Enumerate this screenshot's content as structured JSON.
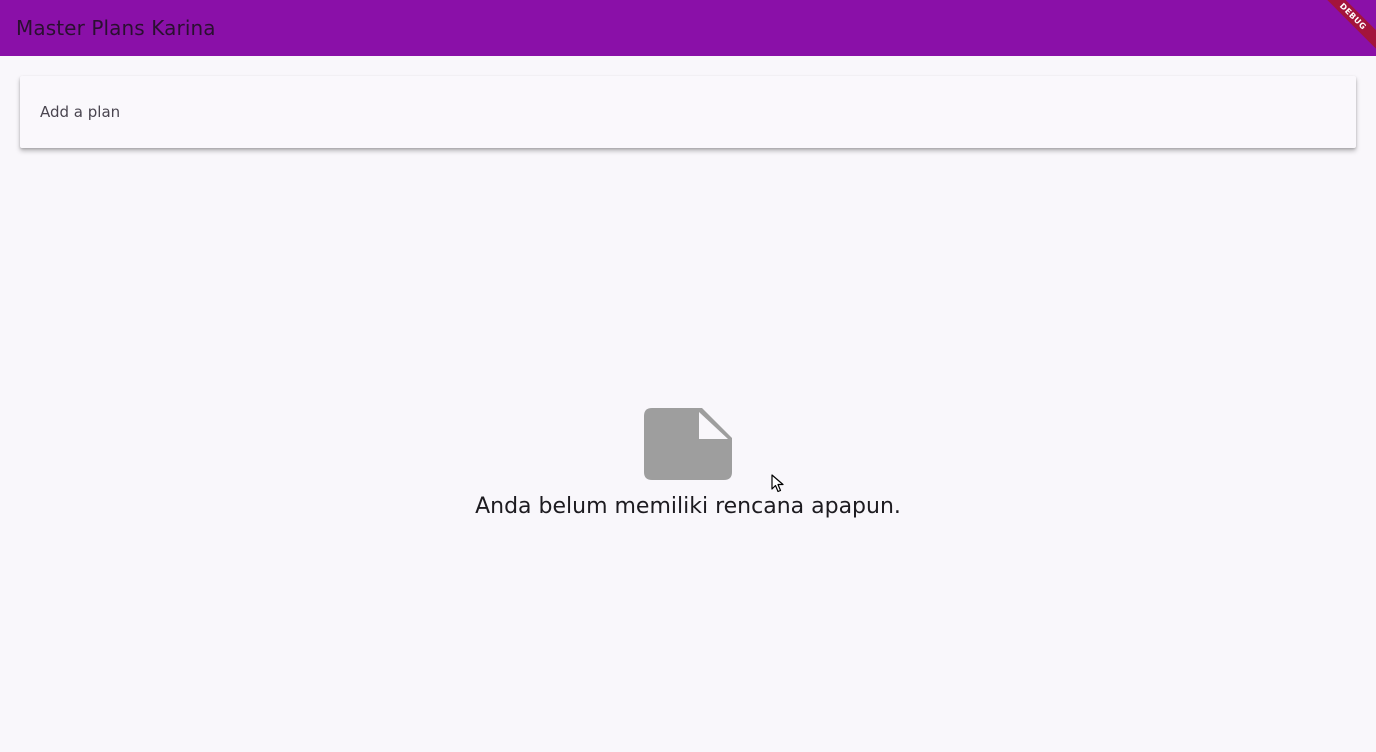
{
  "app_bar": {
    "title": "Master Plans Karina",
    "background": "#8a10a8"
  },
  "debug_banner": {
    "label": "DEBUG",
    "color": "#a3143c"
  },
  "input": {
    "placeholder": "Add a plan",
    "value": ""
  },
  "empty_state": {
    "icon": "note-icon",
    "icon_color": "#9e9e9e",
    "message": "Anda belum memiliki rencana apapun."
  }
}
